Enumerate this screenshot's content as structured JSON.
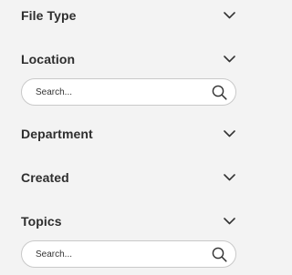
{
  "filters": {
    "file_type": {
      "label": "File Type",
      "icon": "chevron-down-icon"
    },
    "location": {
      "label": "Location",
      "icon": "chevron-down-icon",
      "search": {
        "placeholder": "Search...",
        "value": "",
        "icon": "search-icon"
      }
    },
    "department": {
      "label": "Department",
      "icon": "chevron-down-icon"
    },
    "created": {
      "label": "Created",
      "icon": "chevron-down-icon"
    },
    "topics": {
      "label": "Topics",
      "icon": "chevron-down-icon",
      "search": {
        "placeholder": "Search...",
        "value": "",
        "icon": "search-icon"
      }
    }
  },
  "colors": {
    "background": "#f3f3f3",
    "text": "#2e2e2e",
    "search_border": "#c9c9c9",
    "search_background": "#ffffff"
  }
}
